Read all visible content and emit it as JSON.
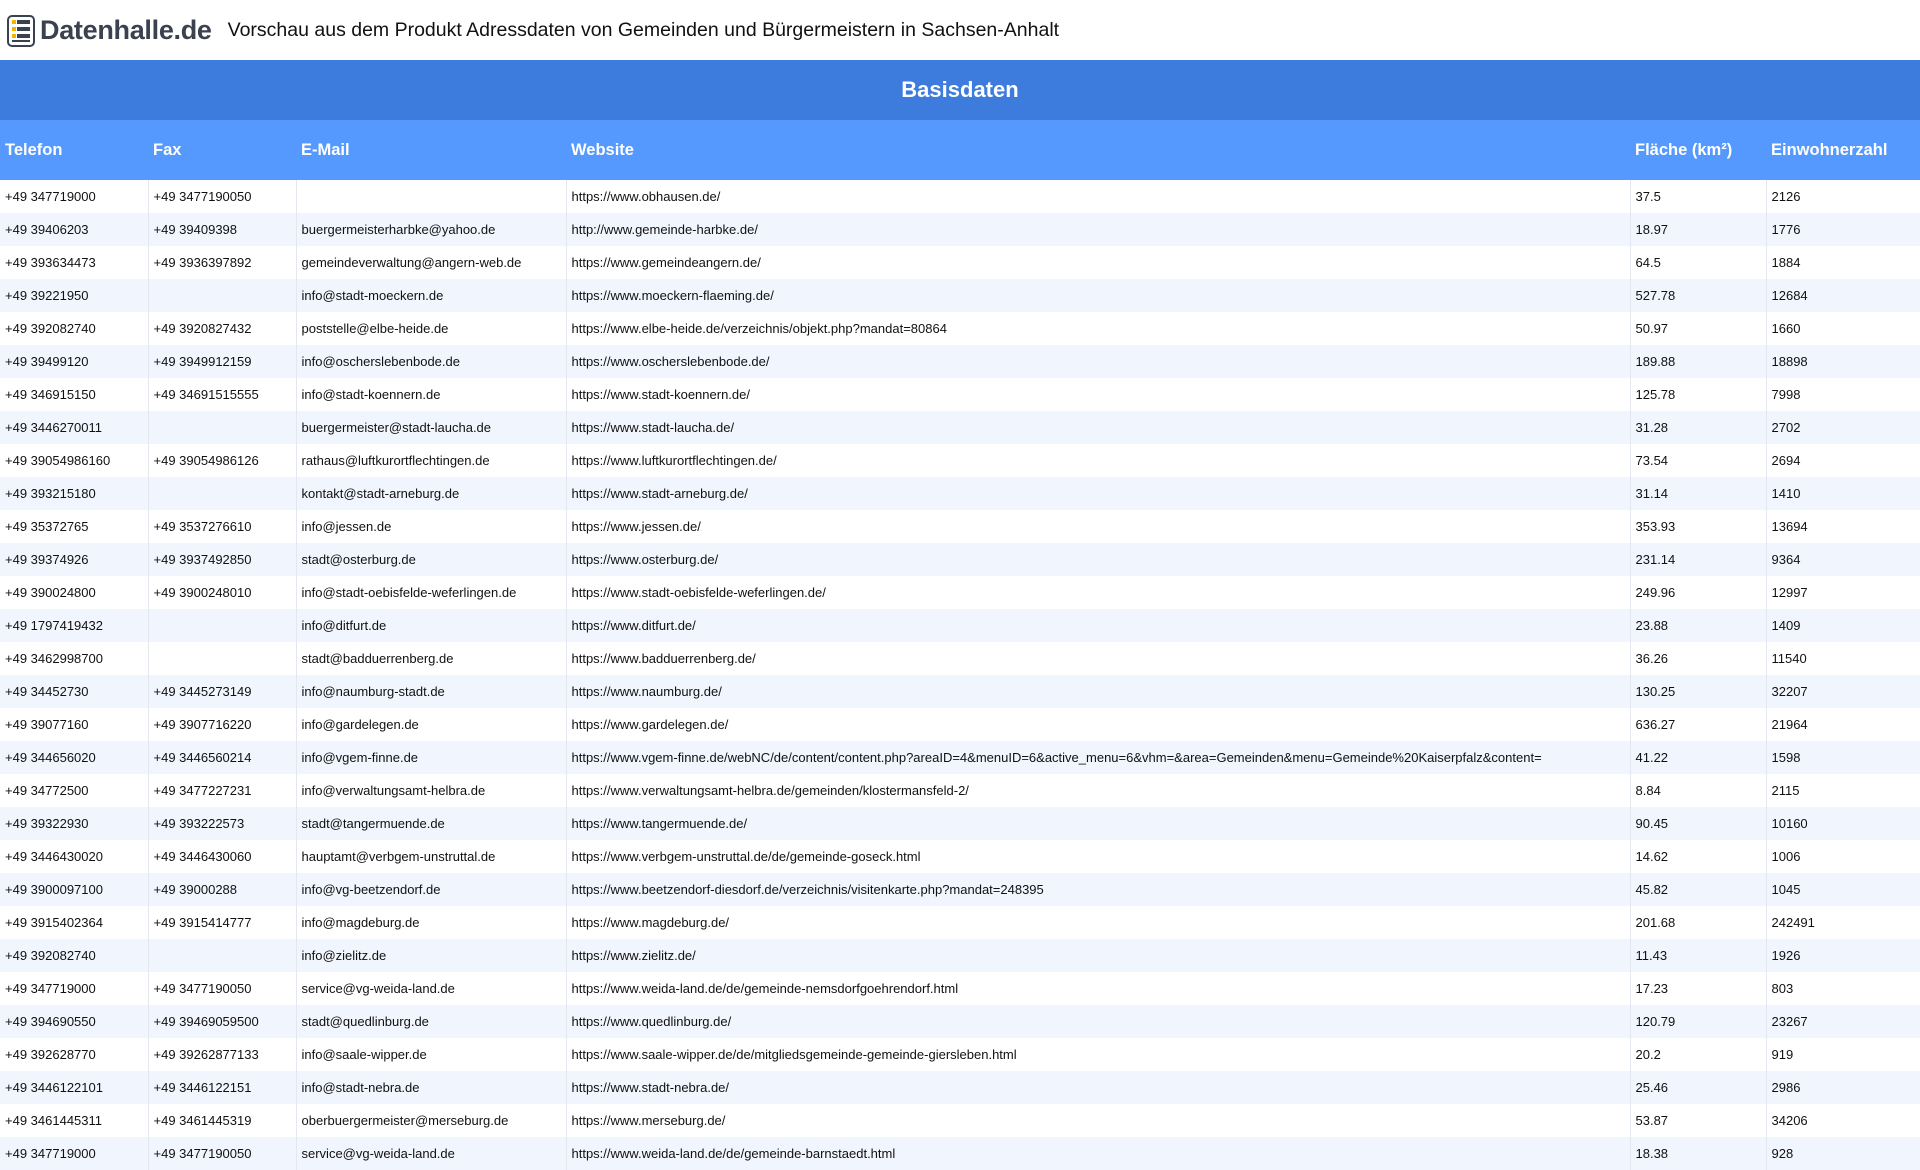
{
  "header": {
    "logo_text": "Datenhalle.de",
    "title": "Vorschau aus dem Produkt Adressdaten von Gemeinden und Bürgermeistern in Sachsen-Anhalt"
  },
  "banner": {
    "label": "Basisdaten"
  },
  "table": {
    "columns": [
      "Telefon",
      "Fax",
      "E-Mail",
      "Website",
      "Fläche (km²)",
      "Einwohnerzahl"
    ],
    "rows": [
      [
        "+49 347719000",
        "+49 3477190050",
        "",
        "https://www.obhausen.de/",
        "37.5",
        "2126"
      ],
      [
        "+49 39406203",
        "+49 39409398",
        "buergermeisterharbke@yahoo.de",
        "http://www.gemeinde-harbke.de/",
        "18.97",
        "1776"
      ],
      [
        "+49 393634473",
        "+49 3936397892",
        "gemeindeverwaltung@angern-web.de",
        "https://www.gemeindeangern.de/",
        "64.5",
        "1884"
      ],
      [
        "+49 39221950",
        "",
        "info@stadt-moeckern.de",
        "https://www.moeckern-flaeming.de/",
        "527.78",
        "12684"
      ],
      [
        "+49 392082740",
        "+49 3920827432",
        "poststelle@elbe-heide.de",
        "https://www.elbe-heide.de/verzeichnis/objekt.php?mandat=80864",
        "50.97",
        "1660"
      ],
      [
        "+49 39499120",
        "+49 3949912159",
        "info@oschersleben bode.de",
        "https://www.oscherslebenbode.de/",
        "189.88",
        "18898"
      ],
      [
        "+49 346915150",
        "+49 34691515555",
        "info@stadt-koennern.de",
        "https://www.stadt-koennern.de/",
        "125.78",
        "7998"
      ],
      [
        "+49 3446270011",
        "",
        "buergermeister@stadt-laucha.de",
        "https://www.stadt-laucha.de/",
        "31.28",
        "2702"
      ],
      [
        "+49 39054986160",
        "+49 39054986126",
        "rathaus@luftkurortflechtingen.de",
        "https://www.luftkurortflechtingen.de/",
        "73.54",
        "2694"
      ],
      [
        "+49 393215180",
        "",
        "kontakt@stadt-arneburg.de",
        "https://www.stadt-arneburg.de/",
        "31.14",
        "1410"
      ],
      [
        "+49 35372765",
        "+49 3537276610",
        "info@jessen.de",
        "https://www.jessen.de/",
        "353.93",
        "13694"
      ],
      [
        "+49 39374926",
        "+49 3937492850",
        "stadt@osterburg.de",
        "https://www.osterburg.de/",
        "231.14",
        "9364"
      ],
      [
        "+49 390024800",
        "+49 3900248010",
        "info@stadt-oebisfelde-weferlingen.de",
        "https://www.stadt-oebisfelde-weferlingen.de/",
        "249.96",
        "12997"
      ],
      [
        "+49 1797419432",
        "",
        "info@ditfurt.de",
        "https://www.ditfurt.de/",
        "23.88",
        "1409"
      ],
      [
        "+49 3462998700",
        "",
        "stadt@badduerrenberg.de",
        "https://www.badduerrenberg.de/",
        "36.26",
        "11540"
      ],
      [
        "+49 34452730",
        "+49 3445273149",
        "info@naumburg-stadt.de",
        "https://www.naumburg.de/",
        "130.25",
        "32207"
      ],
      [
        "+49 39077160",
        "+49 3907716220",
        "info@gardelegen.de",
        "https://www.gardelegen.de/",
        "636.27",
        "21964"
      ],
      [
        "+49 344656020",
        "+49 3446560214",
        "info@vgem-finne.de",
        "https://www.vgem-finne.de/webNC/de/content/content.php?areaID=4&menuID=6&active_menu=6&vhm=&area=Gemeinden&menu=Gemeinde%20Kaiserpfalz&content=",
        "41.22",
        "1598"
      ],
      [
        "+49 34772500",
        "+49 3477227231",
        "info@verwaltungsamt-helbra.de",
        "https://www.verwaltungsamt-helbra.de/gemeinden/klostermansfeld-2/",
        "8.84",
        "2115"
      ],
      [
        "+49 39322930",
        "+49 393222573",
        "stadt@tangermuende.de",
        "https://www.tangermuende.de/",
        "90.45",
        "10160"
      ],
      [
        "+49 3446430020",
        "+49 3446430060",
        "hauptamt@verbgem-unstruttal.de",
        "https://www.verbgem-unstruttal.de/de/gemeinde-goseck.html",
        "14.62",
        "1006"
      ],
      [
        "+49 3900097100",
        "+49 39000288",
        "info@vg-beetzendorf.de",
        "https://www.beetzendorf-diesdorf.de/verzeichnis/visitenkarte.php?mandat=248395",
        "45.82",
        "1045"
      ],
      [
        "+49 3915402364",
        "+49 3915414777",
        "info@magdeburg.de",
        "https://www.magdeburg.de/",
        "201.68",
        "242491"
      ],
      [
        "+49 392082740",
        "",
        "info@zielitz.de",
        "https://www.zielitz.de/",
        "11.43",
        "1926"
      ],
      [
        "+49 347719000",
        "+49 3477190050",
        "service@vg-weida-land.de",
        "https://www.weida-land.de/de/gemeinde-nemsdorfgoehrendorf.html",
        "17.23",
        "803"
      ],
      [
        "+49 394690550",
        "+49 39469059500",
        "stadt@quedlinburg.de",
        "https://www.quedlinburg.de/",
        "120.79",
        "23267"
      ],
      [
        "+49 392628770",
        "+49 39262877133",
        "info@saale-wipper.de",
        "https://www.saale-wipper.de/de/mitgliedsgemeinde-gemeinde-giersleben.html",
        "20.2",
        "919"
      ],
      [
        "+49 3446122101",
        "+49 3446122151",
        "info@stadt-nebra.de",
        "https://www.stadt-nebra.de/",
        "25.46",
        "2986"
      ],
      [
        "+49 3461445311",
        "+49 3461445319",
        "oberbuergermeister@merseburg.de",
        "https://www.merseburg.de/",
        "53.87",
        "34206"
      ],
      [
        "+49 347719000",
        "+49 3477190050",
        "service@vg-weida-land.de",
        "https://www.weida-land.de/de/gemeinde-barnstaedt.html",
        "18.38",
        "928"
      ]
    ]
  },
  "colors": {
    "banner": "#3d7bdc",
    "header_row": "#5599ff",
    "row_alt": "#f1f5fd"
  }
}
